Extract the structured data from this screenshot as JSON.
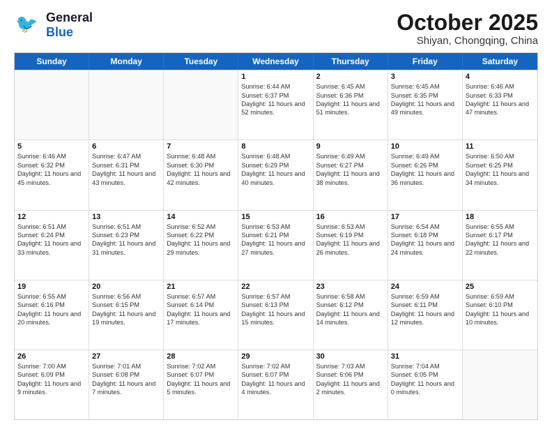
{
  "header": {
    "logo_general": "General",
    "logo_blue": "Blue",
    "month": "October 2025",
    "location": "Shiyan, Chongqing, China"
  },
  "days_of_week": [
    "Sunday",
    "Monday",
    "Tuesday",
    "Wednesday",
    "Thursday",
    "Friday",
    "Saturday"
  ],
  "weeks": [
    [
      {
        "day": "",
        "sunrise": "",
        "sunset": "",
        "daylight": ""
      },
      {
        "day": "",
        "sunrise": "",
        "sunset": "",
        "daylight": ""
      },
      {
        "day": "",
        "sunrise": "",
        "sunset": "",
        "daylight": ""
      },
      {
        "day": "1",
        "sunrise": "Sunrise: 6:44 AM",
        "sunset": "Sunset: 6:37 PM",
        "daylight": "Daylight: 11 hours and 52 minutes."
      },
      {
        "day": "2",
        "sunrise": "Sunrise: 6:45 AM",
        "sunset": "Sunset: 6:36 PM",
        "daylight": "Daylight: 11 hours and 51 minutes."
      },
      {
        "day": "3",
        "sunrise": "Sunrise: 6:45 AM",
        "sunset": "Sunset: 6:35 PM",
        "daylight": "Daylight: 11 hours and 49 minutes."
      },
      {
        "day": "4",
        "sunrise": "Sunrise: 6:46 AM",
        "sunset": "Sunset: 6:33 PM",
        "daylight": "Daylight: 11 hours and 47 minutes."
      }
    ],
    [
      {
        "day": "5",
        "sunrise": "Sunrise: 6:46 AM",
        "sunset": "Sunset: 6:32 PM",
        "daylight": "Daylight: 11 hours and 45 minutes."
      },
      {
        "day": "6",
        "sunrise": "Sunrise: 6:47 AM",
        "sunset": "Sunset: 6:31 PM",
        "daylight": "Daylight: 11 hours and 43 minutes."
      },
      {
        "day": "7",
        "sunrise": "Sunrise: 6:48 AM",
        "sunset": "Sunset: 6:30 PM",
        "daylight": "Daylight: 11 hours and 42 minutes."
      },
      {
        "day": "8",
        "sunrise": "Sunrise: 6:48 AM",
        "sunset": "Sunset: 6:29 PM",
        "daylight": "Daylight: 11 hours and 40 minutes."
      },
      {
        "day": "9",
        "sunrise": "Sunrise: 6:49 AM",
        "sunset": "Sunset: 6:27 PM",
        "daylight": "Daylight: 11 hours and 38 minutes."
      },
      {
        "day": "10",
        "sunrise": "Sunrise: 6:49 AM",
        "sunset": "Sunset: 6:26 PM",
        "daylight": "Daylight: 11 hours and 36 minutes."
      },
      {
        "day": "11",
        "sunrise": "Sunrise: 6:50 AM",
        "sunset": "Sunset: 6:25 PM",
        "daylight": "Daylight: 11 hours and 34 minutes."
      }
    ],
    [
      {
        "day": "12",
        "sunrise": "Sunrise: 6:51 AM",
        "sunset": "Sunset: 6:24 PM",
        "daylight": "Daylight: 11 hours and 33 minutes."
      },
      {
        "day": "13",
        "sunrise": "Sunrise: 6:51 AM",
        "sunset": "Sunset: 6:23 PM",
        "daylight": "Daylight: 11 hours and 31 minutes."
      },
      {
        "day": "14",
        "sunrise": "Sunrise: 6:52 AM",
        "sunset": "Sunset: 6:22 PM",
        "daylight": "Daylight: 11 hours and 29 minutes."
      },
      {
        "day": "15",
        "sunrise": "Sunrise: 6:53 AM",
        "sunset": "Sunset: 6:21 PM",
        "daylight": "Daylight: 11 hours and 27 minutes."
      },
      {
        "day": "16",
        "sunrise": "Sunrise: 6:53 AM",
        "sunset": "Sunset: 6:19 PM",
        "daylight": "Daylight: 11 hours and 26 minutes."
      },
      {
        "day": "17",
        "sunrise": "Sunrise: 6:54 AM",
        "sunset": "Sunset: 6:18 PM",
        "daylight": "Daylight: 11 hours and 24 minutes."
      },
      {
        "day": "18",
        "sunrise": "Sunrise: 6:55 AM",
        "sunset": "Sunset: 6:17 PM",
        "daylight": "Daylight: 11 hours and 22 minutes."
      }
    ],
    [
      {
        "day": "19",
        "sunrise": "Sunrise: 6:55 AM",
        "sunset": "Sunset: 6:16 PM",
        "daylight": "Daylight: 11 hours and 20 minutes."
      },
      {
        "day": "20",
        "sunrise": "Sunrise: 6:56 AM",
        "sunset": "Sunset: 6:15 PM",
        "daylight": "Daylight: 11 hours and 19 minutes."
      },
      {
        "day": "21",
        "sunrise": "Sunrise: 6:57 AM",
        "sunset": "Sunset: 6:14 PM",
        "daylight": "Daylight: 11 hours and 17 minutes."
      },
      {
        "day": "22",
        "sunrise": "Sunrise: 6:57 AM",
        "sunset": "Sunset: 6:13 PM",
        "daylight": "Daylight: 11 hours and 15 minutes."
      },
      {
        "day": "23",
        "sunrise": "Sunrise: 6:58 AM",
        "sunset": "Sunset: 6:12 PM",
        "daylight": "Daylight: 11 hours and 14 minutes."
      },
      {
        "day": "24",
        "sunrise": "Sunrise: 6:59 AM",
        "sunset": "Sunset: 6:11 PM",
        "daylight": "Daylight: 11 hours and 12 minutes."
      },
      {
        "day": "25",
        "sunrise": "Sunrise: 6:59 AM",
        "sunset": "Sunset: 6:10 PM",
        "daylight": "Daylight: 11 hours and 10 minutes."
      }
    ],
    [
      {
        "day": "26",
        "sunrise": "Sunrise: 7:00 AM",
        "sunset": "Sunset: 6:09 PM",
        "daylight": "Daylight: 11 hours and 9 minutes."
      },
      {
        "day": "27",
        "sunrise": "Sunrise: 7:01 AM",
        "sunset": "Sunset: 6:08 PM",
        "daylight": "Daylight: 11 hours and 7 minutes."
      },
      {
        "day": "28",
        "sunrise": "Sunrise: 7:02 AM",
        "sunset": "Sunset: 6:07 PM",
        "daylight": "Daylight: 11 hours and 5 minutes."
      },
      {
        "day": "29",
        "sunrise": "Sunrise: 7:02 AM",
        "sunset": "Sunset: 6:07 PM",
        "daylight": "Daylight: 11 hours and 4 minutes."
      },
      {
        "day": "30",
        "sunrise": "Sunrise: 7:03 AM",
        "sunset": "Sunset: 6:06 PM",
        "daylight": "Daylight: 11 hours and 2 minutes."
      },
      {
        "day": "31",
        "sunrise": "Sunrise: 7:04 AM",
        "sunset": "Sunset: 6:05 PM",
        "daylight": "Daylight: 11 hours and 0 minutes."
      },
      {
        "day": "",
        "sunrise": "",
        "sunset": "",
        "daylight": ""
      }
    ]
  ]
}
